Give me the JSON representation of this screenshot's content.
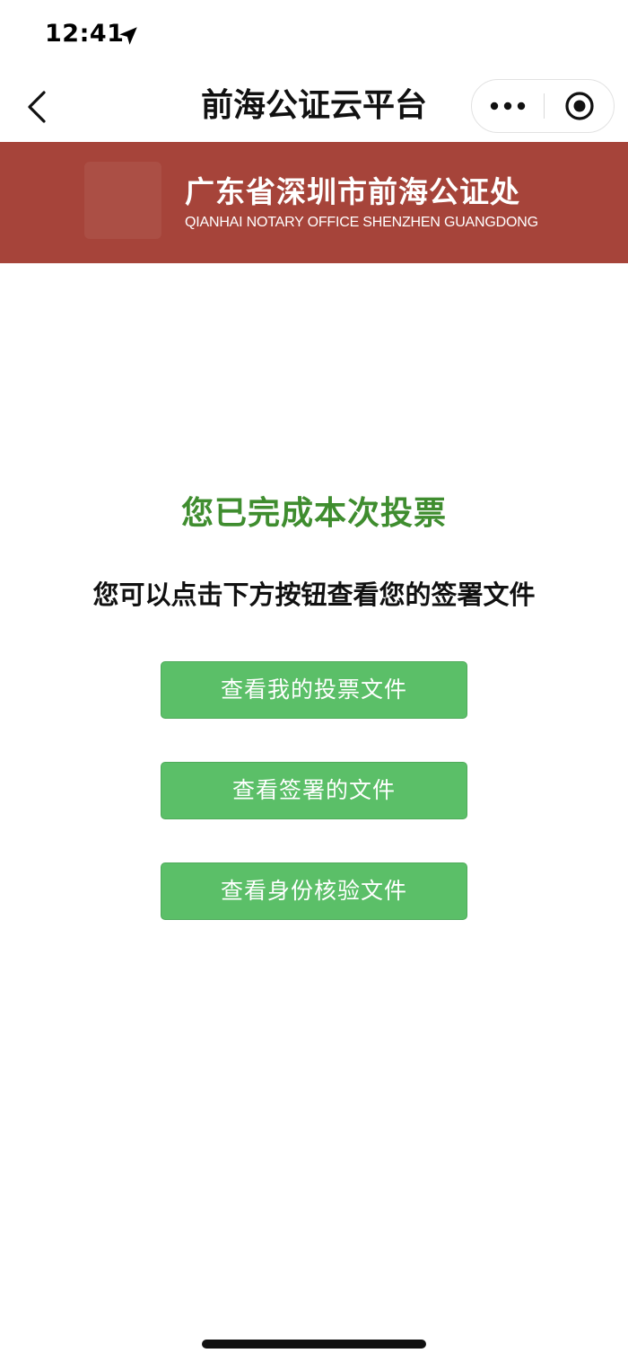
{
  "status_bar": {
    "time": "12:41",
    "location_icon": "location-arrow-icon"
  },
  "nav": {
    "title": "前海公证云平台",
    "back_icon": "chevron-left-icon",
    "more_icon": "more-dots-icon",
    "close_icon": "target-close-icon"
  },
  "banner": {
    "title": "广东省深圳市前海公证处",
    "subtitle": "QIANHAI NOTARY OFFICE SHENZHEN GUANGDONG",
    "background_color": "#a6443a"
  },
  "main": {
    "done_title": "您已完成本次投票",
    "instruction": "您可以点击下方按钮查看您的签署文件",
    "buttons": [
      {
        "label": "查看我的投票文件"
      },
      {
        "label": "查看签署的文件"
      },
      {
        "label": "查看身份核验文件"
      }
    ],
    "accent_color": "#3f8d2f",
    "button_color": "#5bbf68"
  }
}
